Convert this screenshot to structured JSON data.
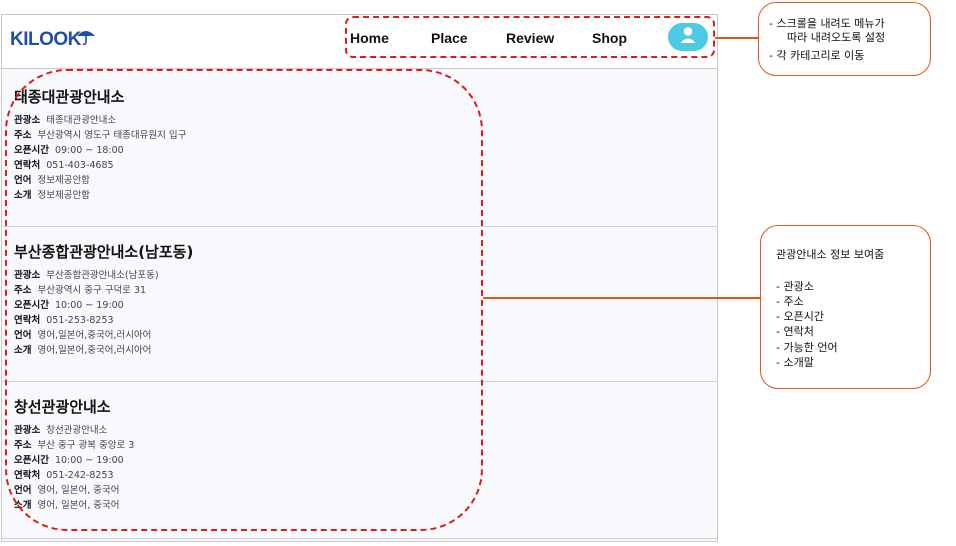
{
  "header": {
    "logo_text": "KILOOK",
    "nav": [
      "Home",
      "Place",
      "Review",
      "Shop"
    ]
  },
  "labels": {
    "spot": "관광소",
    "address": "주소",
    "hours": "오픈시간",
    "contact": "연락처",
    "language": "언어",
    "intro": "소개"
  },
  "centers": [
    {
      "name": "태종대관광안내소",
      "spot": "태종대관광안내소",
      "address": "부산광역시 영도구 태종대유원지 입구",
      "hours": "09:00 ~ 18:00",
      "contact": "051-403-4685",
      "language": "정보제공안함",
      "intro": "정보제공안함"
    },
    {
      "name": "부산종합관광안내소(남포동)",
      "spot": "부산종합관광안내소(남포동)",
      "address": "부산광역시 중구 구덕로 31",
      "hours": "10:00 ~ 19:00",
      "contact": "051-253-8253",
      "language": "영어,일본어,중국어,러시아어",
      "intro": "영어,일본어,중국어,러시아어"
    },
    {
      "name": "창선관광안내소",
      "spot": "창선관광안내소",
      "address": "부산 중구 광복 중앙로 3",
      "hours": "10:00 ~ 19:00",
      "contact": "051-242-8253",
      "language": "영어, 일본어, 중국어",
      "intro": "영어, 일본어, 중국어"
    }
  ],
  "annotations": {
    "menu": [
      "-  스크롤을 내려도 메뉴가",
      "따라 내려오도록 설정",
      "-  각 카테고리로 이동"
    ],
    "info": {
      "title": "관광안내소 정보 보여줌",
      "items": [
        "-        관광소",
        "-        주소",
        "-        오픈시간",
        "-        연락처",
        "-        가능한 언어",
        "-        소개말"
      ]
    }
  },
  "colors": {
    "logo": "#1f4fa8",
    "avatar": "#4ec9e6",
    "dashed_outline": "#e11b1b",
    "callout_border": "#e0571a"
  }
}
